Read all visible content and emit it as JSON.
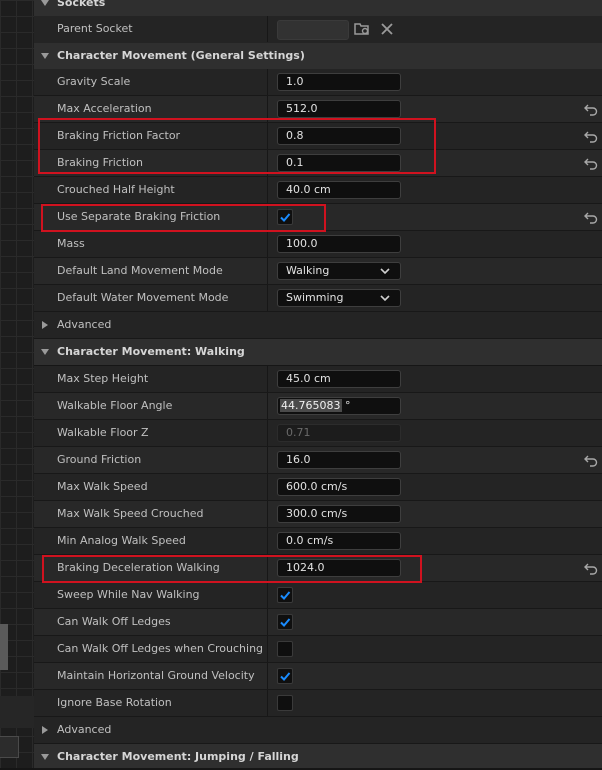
{
  "sections": {
    "sockets": "Sockets",
    "general": "Character Movement (General Settings)",
    "walking": "Character Movement: Walking",
    "jumping": "Character Movement: Jumping / Falling"
  },
  "sockets": {
    "parent_socket": "Parent Socket"
  },
  "general": {
    "gravity_scale": {
      "label": "Gravity Scale",
      "value": "1.0"
    },
    "max_acceleration": {
      "label": "Max Acceleration",
      "value": "512.0"
    },
    "braking_friction_factor": {
      "label": "Braking Friction Factor",
      "value": "0.8"
    },
    "braking_friction": {
      "label": "Braking Friction",
      "value": "0.1"
    },
    "crouched_half_height": {
      "label": "Crouched Half Height",
      "value": "40.0 cm"
    },
    "use_separate_braking_friction": {
      "label": "Use Separate Braking Friction",
      "checked": true
    },
    "mass": {
      "label": "Mass",
      "value": "100.0"
    },
    "default_land_movement_mode": {
      "label": "Default Land Movement Mode",
      "value": "Walking"
    },
    "default_water_movement_mode": {
      "label": "Default Water Movement Mode",
      "value": "Swimming"
    },
    "advanced": "Advanced"
  },
  "walking": {
    "max_step_height": {
      "label": "Max Step Height",
      "value": "45.0 cm"
    },
    "walkable_floor_angle": {
      "label": "Walkable Floor Angle",
      "value": "44.765083",
      "unit": "°"
    },
    "walkable_floor_z": {
      "label": "Walkable Floor Z",
      "value": "0.71"
    },
    "ground_friction": {
      "label": "Ground Friction",
      "value": "16.0"
    },
    "max_walk_speed": {
      "label": "Max Walk Speed",
      "value": "600.0 cm/s"
    },
    "max_walk_speed_crouched": {
      "label": "Max Walk Speed Crouched",
      "value": "300.0 cm/s"
    },
    "min_analog_walk_speed": {
      "label": "Min Analog Walk Speed",
      "value": "0.0 cm/s"
    },
    "braking_deceleration_walking": {
      "label": "Braking Deceleration Walking",
      "value": "1024.0"
    },
    "sweep_while_nav_walking": {
      "label": "Sweep While Nav Walking",
      "checked": true
    },
    "can_walk_off_ledges": {
      "label": "Can Walk Off Ledges",
      "checked": true
    },
    "can_walk_off_ledges_crouching": {
      "label": "Can Walk Off Ledges when Crouching",
      "checked": false
    },
    "maintain_horizontal_ground_velocity": {
      "label": "Maintain Horizontal Ground Velocity",
      "checked": true
    },
    "ignore_base_rotation": {
      "label": "Ignore Base Rotation",
      "checked": false
    },
    "advanced": "Advanced"
  },
  "colors": {
    "highlight": "#d0121f",
    "check": "#1a8cff",
    "panel": "#242424"
  },
  "icons": {
    "section_expanded": "triangle-down-icon",
    "section_collapsed": "triangle-right-icon",
    "reset": "reset-to-default-icon",
    "browse": "browse-folder-icon",
    "clear": "clear-x-icon",
    "dropdown": "chevron-down-icon",
    "checkmark": "checkmark-icon"
  }
}
